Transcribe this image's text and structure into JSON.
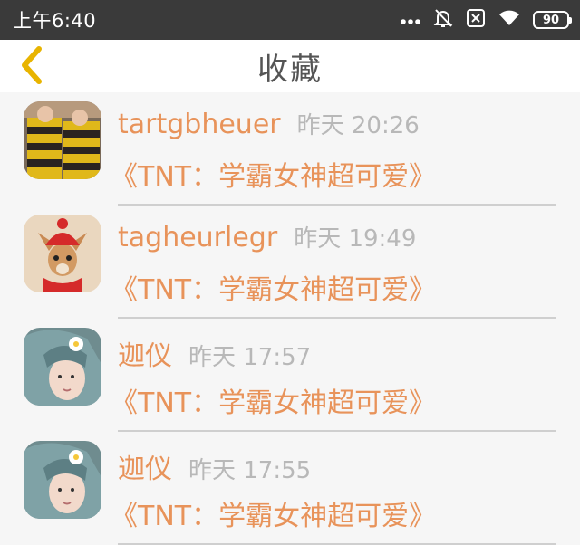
{
  "status_bar": {
    "time": "上午6:40",
    "battery": "90",
    "icons": [
      "more-dots-icon",
      "mute-bell-icon",
      "sim-x-icon",
      "wifi-icon",
      "battery-icon"
    ]
  },
  "navbar": {
    "title": "收藏",
    "back_icon": "chevron-left-icon",
    "accent": "#e8b400"
  },
  "items": [
    {
      "username": "tartgbheuer",
      "time": "昨天 20:26",
      "subject": "《TNT：学霸女神超可爱》",
      "avatar": "striped-sweater-kids"
    },
    {
      "username": "tagheurlegr",
      "time": "昨天 19:49",
      "subject": "《TNT：学霸女神超可爱》",
      "avatar": "dog-red-beanie"
    },
    {
      "username": "迦仪",
      "time": "昨天 17:57",
      "subject": "《TNT：学霸女神超可爱》",
      "avatar": "girl-blue-hair-flower"
    },
    {
      "username": "迦仪",
      "time": "昨天 17:55",
      "subject": "《TNT：学霸女神超可爱》",
      "avatar": "girl-blue-hair-flower"
    }
  ],
  "colors": {
    "accent_orange": "#e8935a",
    "status_bar_bg": "#3a3a3a",
    "list_bg": "#f6f6f6"
  }
}
